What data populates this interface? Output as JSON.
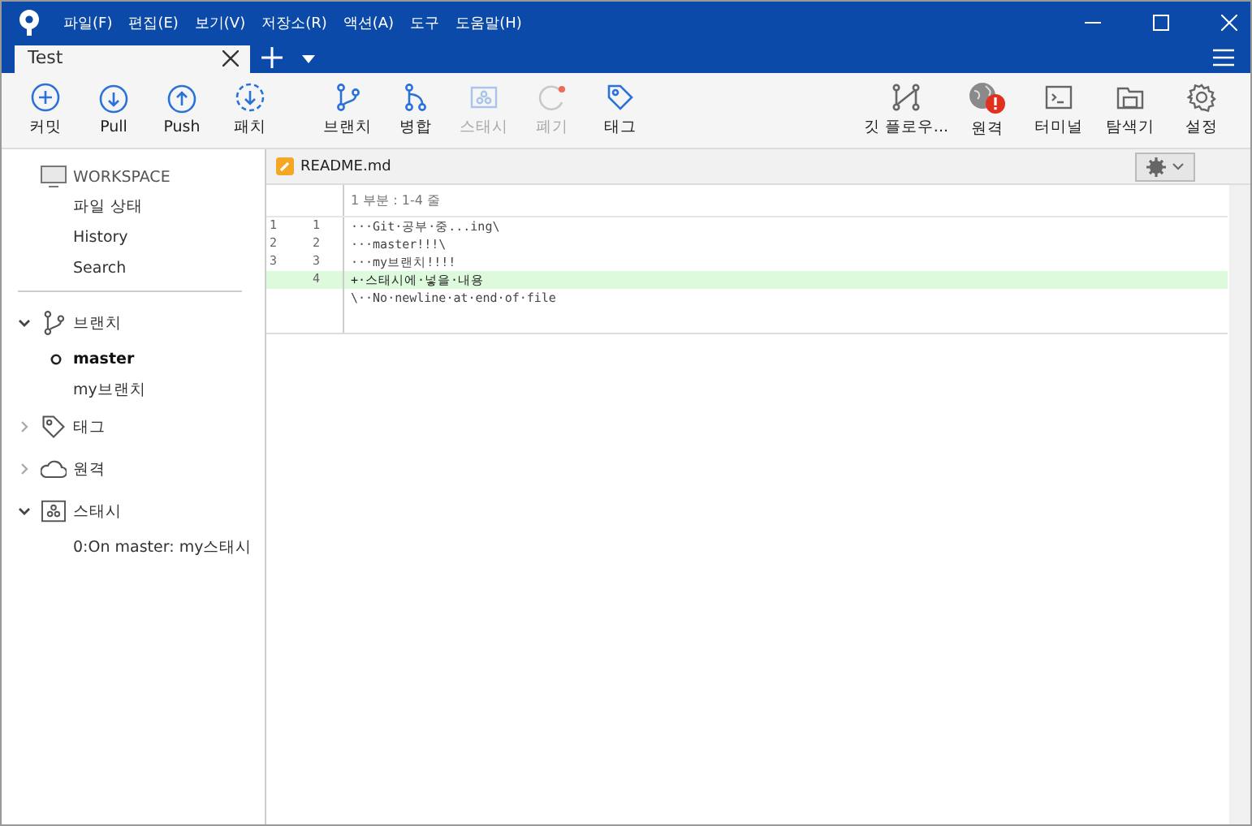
{
  "menu": [
    "파일(F)",
    "편집(E)",
    "보기(V)",
    "저장소(R)",
    "액션(A)",
    "도구",
    "도움말(H)"
  ],
  "tabs": [
    {
      "label": "Test",
      "selected": true
    }
  ],
  "toolbar_left": [
    {
      "kind": "commit",
      "label": "커밋",
      "disabled": false
    },
    {
      "kind": "pull",
      "label": "Pull",
      "disabled": false
    },
    {
      "kind": "push",
      "label": "Push",
      "disabled": false
    },
    {
      "kind": "fetch",
      "label": "패치",
      "disabled": false
    },
    {
      "kind": "branch",
      "label": "브랜치",
      "disabled": false
    },
    {
      "kind": "merge",
      "label": "병합",
      "disabled": false
    },
    {
      "kind": "stash",
      "label": "스태시",
      "disabled": true
    },
    {
      "kind": "discard",
      "label": "폐기",
      "disabled": true
    },
    {
      "kind": "tag",
      "label": "태그",
      "disabled": false
    }
  ],
  "toolbar_right": [
    {
      "kind": "flow",
      "label": "깃 플로우...",
      "disabled": false
    },
    {
      "kind": "remote",
      "label": "원격",
      "disabled": false
    },
    {
      "kind": "terminal",
      "label": "터미널",
      "disabled": false
    },
    {
      "kind": "explorer",
      "label": "탐색기",
      "disabled": false
    },
    {
      "kind": "settings",
      "label": "설정",
      "disabled": false
    }
  ],
  "workspace": {
    "title": "WORKSPACE",
    "items": [
      "파일 상태",
      "History",
      "Search"
    ]
  },
  "sections": [
    {
      "kind": "branch",
      "label": "브랜치",
      "expanded": true,
      "children": [
        {
          "label": "master",
          "current": true
        },
        {
          "label": "my브랜치",
          "current": false
        }
      ]
    },
    {
      "kind": "tag",
      "label": "태그",
      "expanded": false
    },
    {
      "kind": "remote",
      "label": "원격",
      "expanded": false
    },
    {
      "kind": "stash",
      "label": "스태시",
      "expanded": true,
      "children": [
        {
          "label": "0:On master: my스태시",
          "current": false
        }
      ]
    }
  ],
  "file": {
    "name": "README.md",
    "hunk": "1 부분 : 1-4 줄",
    "lines": [
      {
        "kind": "context",
        "old": "1",
        "new": "1",
        "text": "···Git·공부·중...ing\\"
      },
      {
        "kind": "context",
        "old": "2",
        "new": "2",
        "text": "···master!!!\\"
      },
      {
        "kind": "context",
        "old": "3",
        "new": "3",
        "text": "···my브랜치!!!!"
      },
      {
        "kind": "added",
        "new": "4",
        "text": "+·스태시에·넣을·내용"
      },
      {
        "kind": "note",
        "text": "\\··No·newline·at·end·of·file"
      }
    ]
  }
}
